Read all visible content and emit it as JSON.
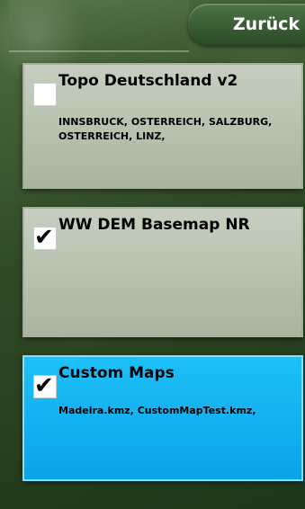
{
  "header": {
    "back_label": "Zurück"
  },
  "maps": [
    {
      "title": "Topo Deutschland v2",
      "description": "INNSBRUCK, OSTERREICH, SALZBURG, OSTERREICH, LINZ,",
      "checked": false,
      "selected": false
    },
    {
      "title": "WW DEM Basemap NR",
      "description": "",
      "checked": true,
      "selected": false
    },
    {
      "title": "Custom Maps",
      "description": "Madeira.kmz, CustomMapTest.kmz,",
      "checked": true,
      "selected": true
    }
  ],
  "colors": {
    "selected": "#0aa3e8",
    "card": "#b7c2ad",
    "background": "#2f4a27"
  },
  "icons": {
    "check": "check-icon",
    "back": "back-button"
  }
}
